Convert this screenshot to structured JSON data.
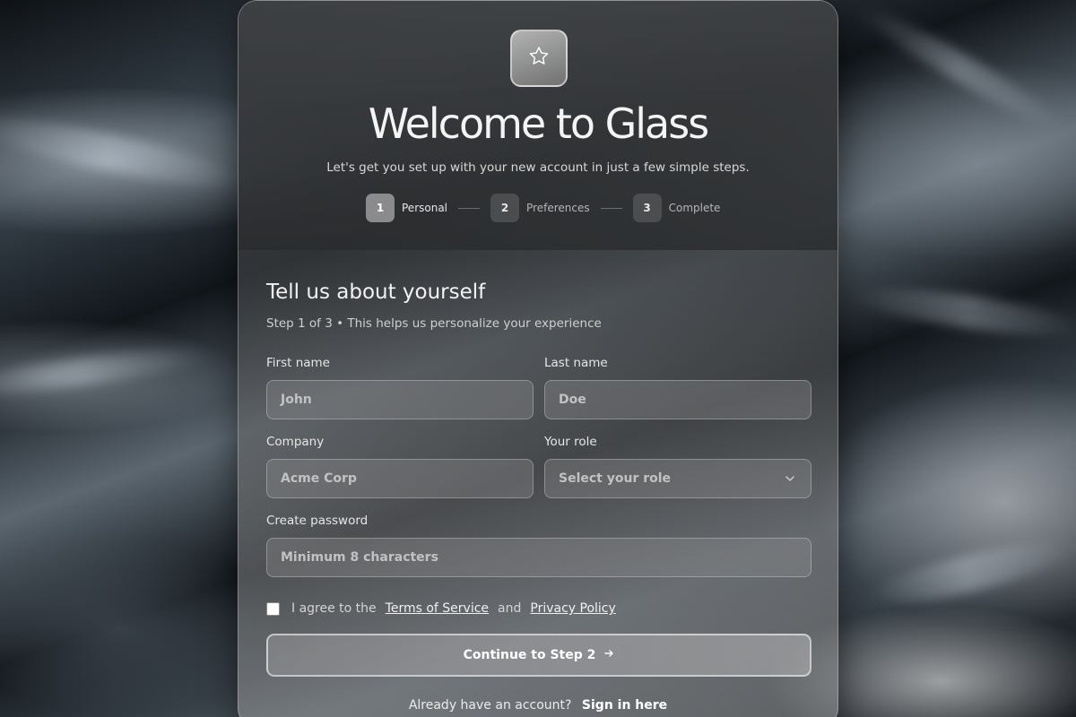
{
  "header": {
    "logo_icon": "star-icon",
    "title": "Welcome to Glass",
    "subtitle": "Let's get you set up with your new account in just a few simple steps."
  },
  "steps": [
    {
      "number": "1",
      "label": "Personal",
      "active": true
    },
    {
      "number": "2",
      "label": "Preferences",
      "active": false
    },
    {
      "number": "3",
      "label": "Complete",
      "active": false
    }
  ],
  "form": {
    "title": "Tell us about yourself",
    "subtitle": "Step 1 of 3 • This helps us personalize your experience",
    "first_name": {
      "label": "First name",
      "placeholder": "John",
      "value": ""
    },
    "last_name": {
      "label": "Last name",
      "placeholder": "Doe",
      "value": ""
    },
    "company": {
      "label": "Company",
      "placeholder": "Acme Corp",
      "value": ""
    },
    "role": {
      "label": "Your role",
      "selected": "Select your role",
      "icon": "chevron-down-icon"
    },
    "password": {
      "label": "Create password",
      "placeholder": "Minimum 8 characters",
      "value": ""
    },
    "agreement": {
      "prefix": "I agree to the",
      "terms": "Terms of Service",
      "and": "and",
      "privacy": "Privacy Policy",
      "checked": false
    },
    "continue_label": "Continue to Step 2",
    "continue_icon": "arrow-right-icon"
  },
  "footer": {
    "prompt": "Already have an account?",
    "signin_label": "Sign in here"
  }
}
